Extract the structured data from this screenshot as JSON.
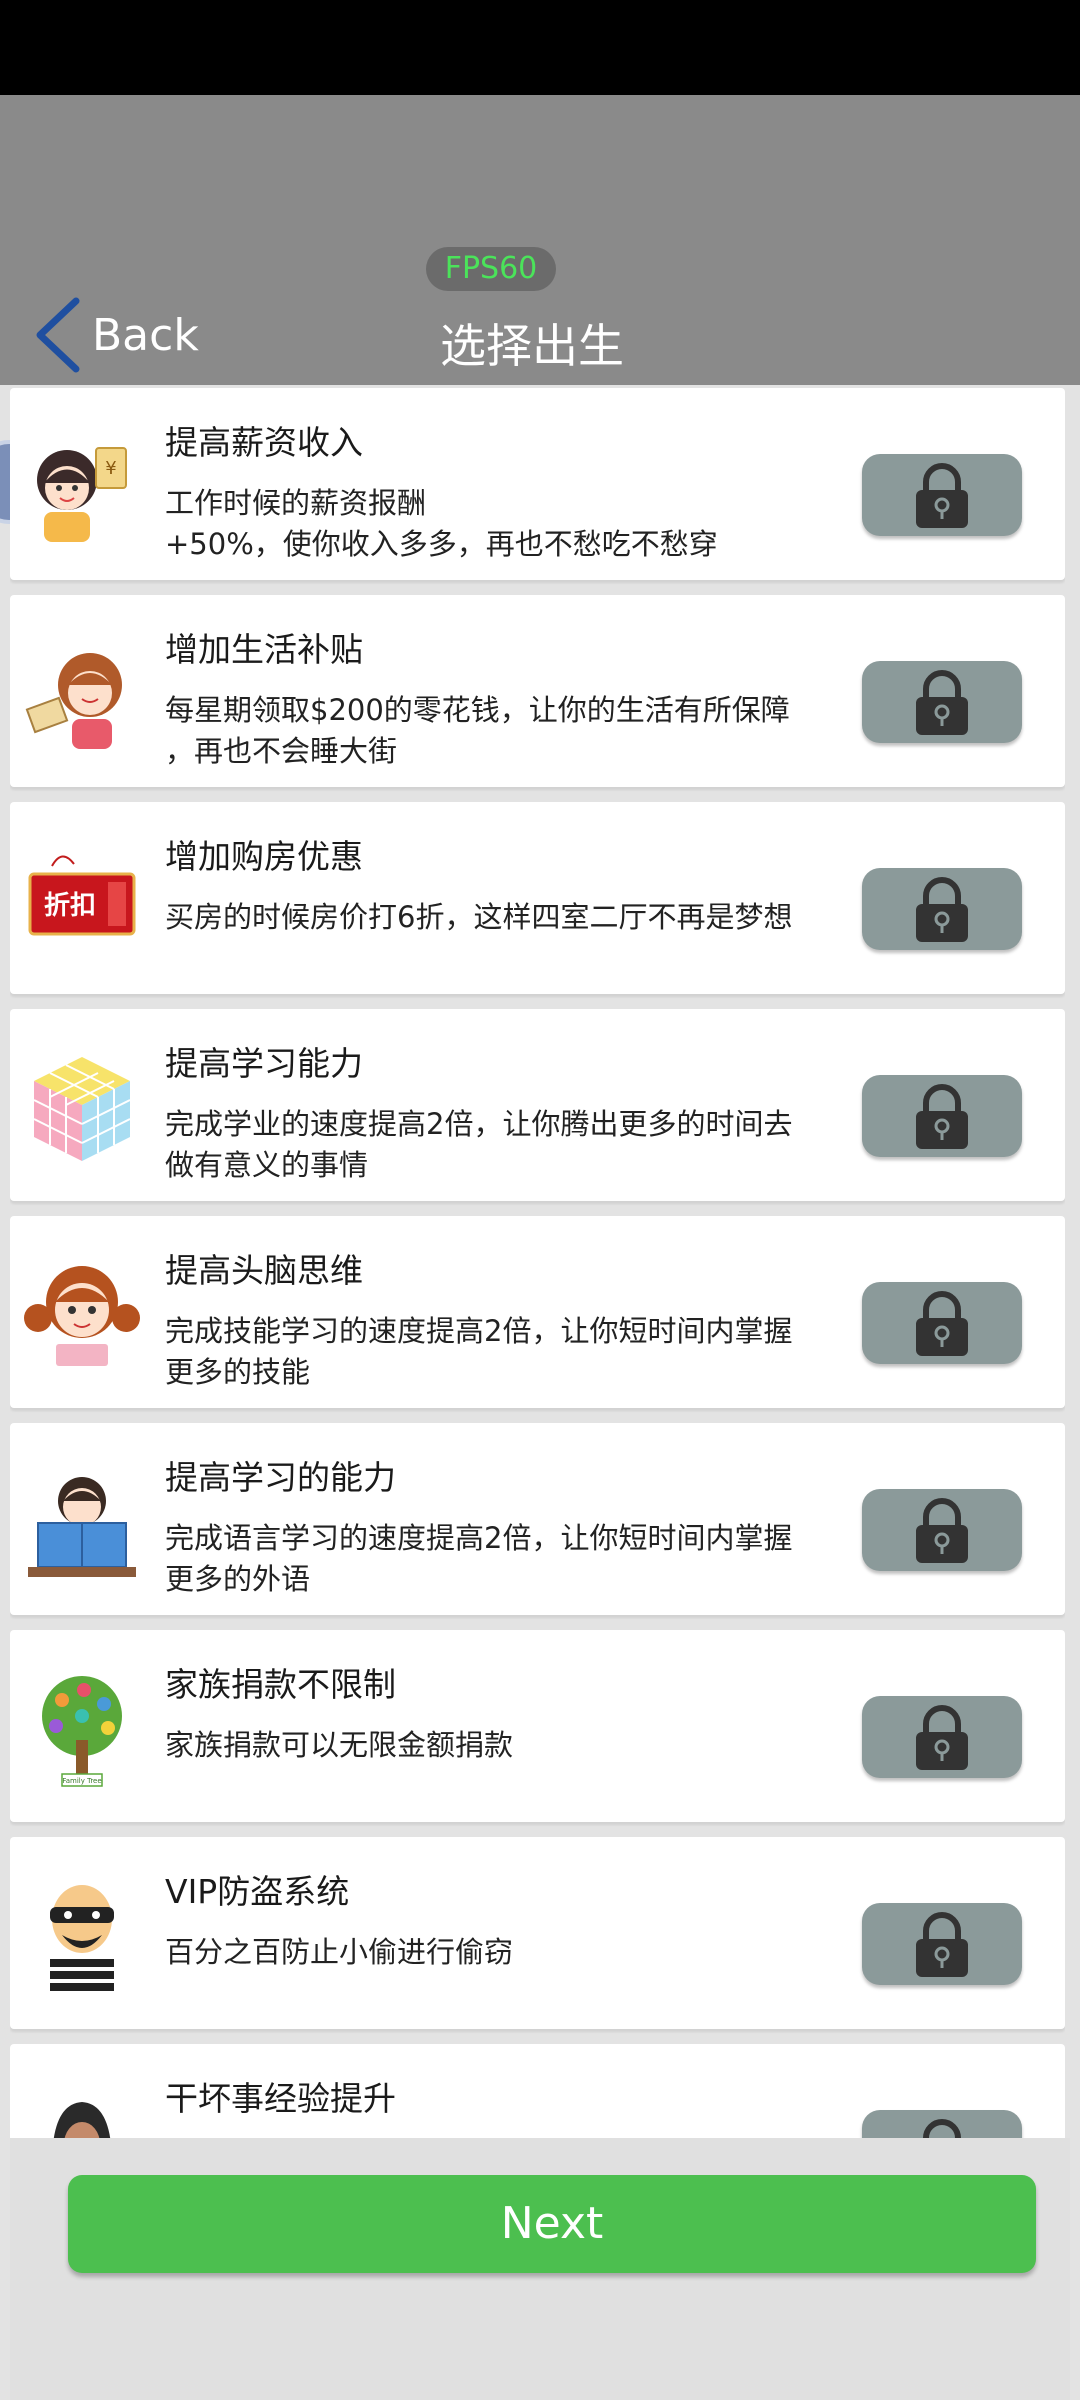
{
  "header": {
    "fps": "FPS60",
    "back_label": "Back",
    "title": "选择出生"
  },
  "items": [
    {
      "title": "提高薪资收入",
      "desc": "工作时候的薪资报酬\n+50%，使你收入多多，再也不愁吃不愁穿",
      "icon": "woman-money-icon"
    },
    {
      "title": "增加生活补贴",
      "desc": "每星期领取$200的零花钱，让你的生活有所保障\n，再也不会睡大街",
      "icon": "girl-envelope-icon"
    },
    {
      "title": "增加购房优惠",
      "desc": "买房的时候房价打6折，这样四室二厅不再是梦想",
      "icon": "discount-tag-icon"
    },
    {
      "title": "提高学习能力",
      "desc": "完成学业的速度提高2倍，让你腾出更多的时间去\n做有意义的事情",
      "icon": "rubiks-cube-icon"
    },
    {
      "title": "提高头脑思维",
      "desc": "完成技能学习的速度提高2倍，让你短时间内掌握\n更多的技能",
      "icon": "girl-reading-icon"
    },
    {
      "title": "提高学习的能力",
      "desc": "完成语言学习的速度提高2倍，让你短时间内掌握\n更多的外语",
      "icon": "boy-book-icon"
    },
    {
      "title": "家族捐款不限制",
      "desc": "家族捐款可以无限金额捐款",
      "icon": "family-tree-icon"
    },
    {
      "title": "VIP防盗系统",
      "desc": "百分之百防止小偷进行偷窃",
      "icon": "thief-icon"
    },
    {
      "title": "干坏事经验提升",
      "desc": "",
      "icon": "hooded-figure-icon"
    }
  ],
  "tag_text": "折扣",
  "tree_label": "Family Tree",
  "next_label": "Next",
  "colors": {
    "accent_green": "#4cbf4f",
    "fps_green": "#4be35a",
    "lock_button": "#8b9a9a",
    "header": "#8a8a8a"
  }
}
